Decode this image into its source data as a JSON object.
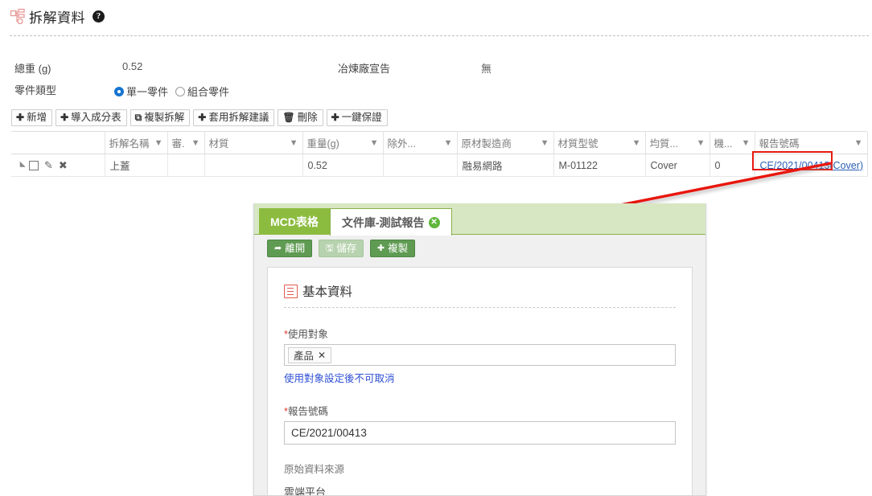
{
  "header": {
    "title": "拆解資料",
    "help_icon": "question-mark-icon",
    "hierarchy_icon": "hierarchy-icon"
  },
  "summary": {
    "total_weight_label": "總重 (g)",
    "total_weight_value": "0.52",
    "smelter_declaration_label": "冶煉廠宣告",
    "smelter_declaration_value": "無",
    "part_type_label": "零件類型",
    "part_type_options": [
      {
        "label": "單一零件",
        "selected": true
      },
      {
        "label": "組合零件",
        "selected": false
      }
    ]
  },
  "toolbar": {
    "buttons": [
      {
        "icon": "plus-icon",
        "glyph": "✚",
        "label": "新增"
      },
      {
        "icon": "plus-icon",
        "glyph": "✚",
        "label": "導入成分表"
      },
      {
        "icon": "copy-icon",
        "glyph": "⧉",
        "label": "複製拆解"
      },
      {
        "icon": "plus-icon",
        "glyph": "✚",
        "label": "套用拆解建議"
      },
      {
        "icon": "trash-icon",
        "glyph": "🗑",
        "label": "刪除"
      },
      {
        "icon": "plus-icon",
        "glyph": "✚",
        "label": "一鍵保證"
      }
    ]
  },
  "grid": {
    "columns": [
      {
        "key": "tools",
        "label": "",
        "filter": false,
        "width": 116
      },
      {
        "key": "name",
        "label": "拆解名稱",
        "filter": true,
        "width": 78
      },
      {
        "key": "review",
        "label": "審.",
        "filter": true,
        "width": 46
      },
      {
        "key": "material",
        "label": "材質",
        "filter": true,
        "width": 122
      },
      {
        "key": "weight",
        "label": "重量(g)",
        "filter": true,
        "width": 100
      },
      {
        "key": "exclude",
        "label": "除外...",
        "filter": true,
        "width": 92
      },
      {
        "key": "maker",
        "label": "原材製造商",
        "filter": true,
        "width": 120
      },
      {
        "key": "model",
        "label": "材質型號",
        "filter": true,
        "width": 114
      },
      {
        "key": "homogeneous",
        "label": "均質...",
        "filter": true,
        "width": 80
      },
      {
        "key": "machine",
        "label": "機...",
        "filter": true,
        "width": 56
      },
      {
        "key": "report_no",
        "label": "報告號碼",
        "filter": true,
        "width": 140
      }
    ],
    "rows": [
      {
        "tools": {
          "expand_icon": "collapse-triangle-icon",
          "checkbox": false,
          "edit_icon": "pencil-icon",
          "delete_icon": "x-icon"
        },
        "name": "上蓋",
        "review": "",
        "material": "",
        "weight": "0.52",
        "exclude": "",
        "maker": "融易網路",
        "model": "M-01122",
        "homogeneous": "Cover",
        "machine": "0",
        "report_no_link": "CE/2021/00413",
        "report_no_suffix": "(Cover)"
      }
    ],
    "filter_icon": "filter-icon",
    "highlight_color": "#e8190f"
  },
  "annotation": {
    "arrow_color": "#e8190f",
    "arrow_name": "red-pointer-arrow"
  },
  "panel": {
    "tabs": [
      {
        "label": "MCD表格",
        "active": false,
        "closable": false
      },
      {
        "label": "文件庫-測試報告",
        "active": true,
        "closable": true,
        "close_icon": "close-circle-icon"
      }
    ],
    "buttons": [
      {
        "icon": "exit-icon",
        "glyph": "⇥",
        "label": "離開",
        "state": "normal"
      },
      {
        "icon": "save-icon",
        "glyph": "💾",
        "label": "儲存",
        "state": "disabled"
      },
      {
        "icon": "plus-icon",
        "glyph": "✚",
        "label": "複製",
        "state": "normal"
      }
    ],
    "section": {
      "icon": "list-icon",
      "title": "基本資料"
    },
    "fields": {
      "usage_target": {
        "required_mark": "*",
        "label": "使用對象",
        "chip": "產品",
        "chip_remove_icon": "x-icon",
        "hint": "使用對象設定後不可取消"
      },
      "report_no": {
        "required_mark": "*",
        "label": "報告號碼",
        "value": "CE/2021/00413"
      },
      "source": {
        "label": "原始資料來源",
        "value": "雲端平台"
      }
    }
  }
}
